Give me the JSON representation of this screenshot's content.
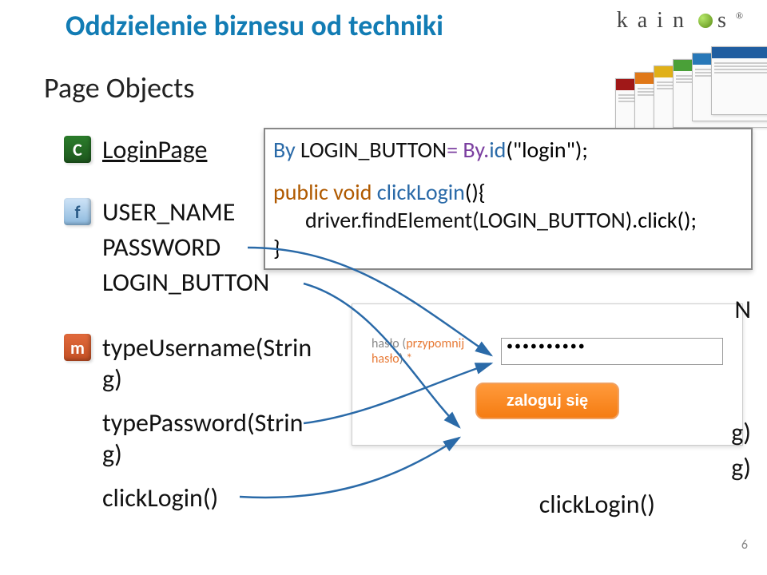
{
  "title": "Oddzielenie biznesu od techniki",
  "logo": {
    "brand": "kain",
    "suffix": "s",
    "tm": "®"
  },
  "section": "Page Objects",
  "class_name": "LoginPage",
  "fields": [
    "USER_NAME",
    "PASSWORD",
    "LOGIN_BUTTON"
  ],
  "methods": [
    "typeUsername(String)",
    "typePassword(String)",
    "clickLogin()"
  ],
  "code": {
    "line1_a": "By ",
    "line1_b": "LOGIN_BUTTON",
    "line1_c": "= By.",
    "line1_d": "id",
    "line1_e": "(\"login\");",
    "line2_a": "public void ",
    "line2_b": "clickLogin",
    "line2_c": "(){",
    "line3_a": "driver.findElement(",
    "line3_b": "LOGIN_BUTTON",
    "line3_c": ").click();",
    "line4": "}"
  },
  "login_form": {
    "password_label_a": "hasło (",
    "password_label_link": "przypomnij hasło",
    "password_label_b": ")",
    "star": "*",
    "password_value": "••••••••••",
    "button": "zaloguj się"
  },
  "right_fragments": {
    "n": "N",
    "g1": "g)",
    "g2": "g)",
    "click": "clickLogin()"
  },
  "page_number": "6"
}
